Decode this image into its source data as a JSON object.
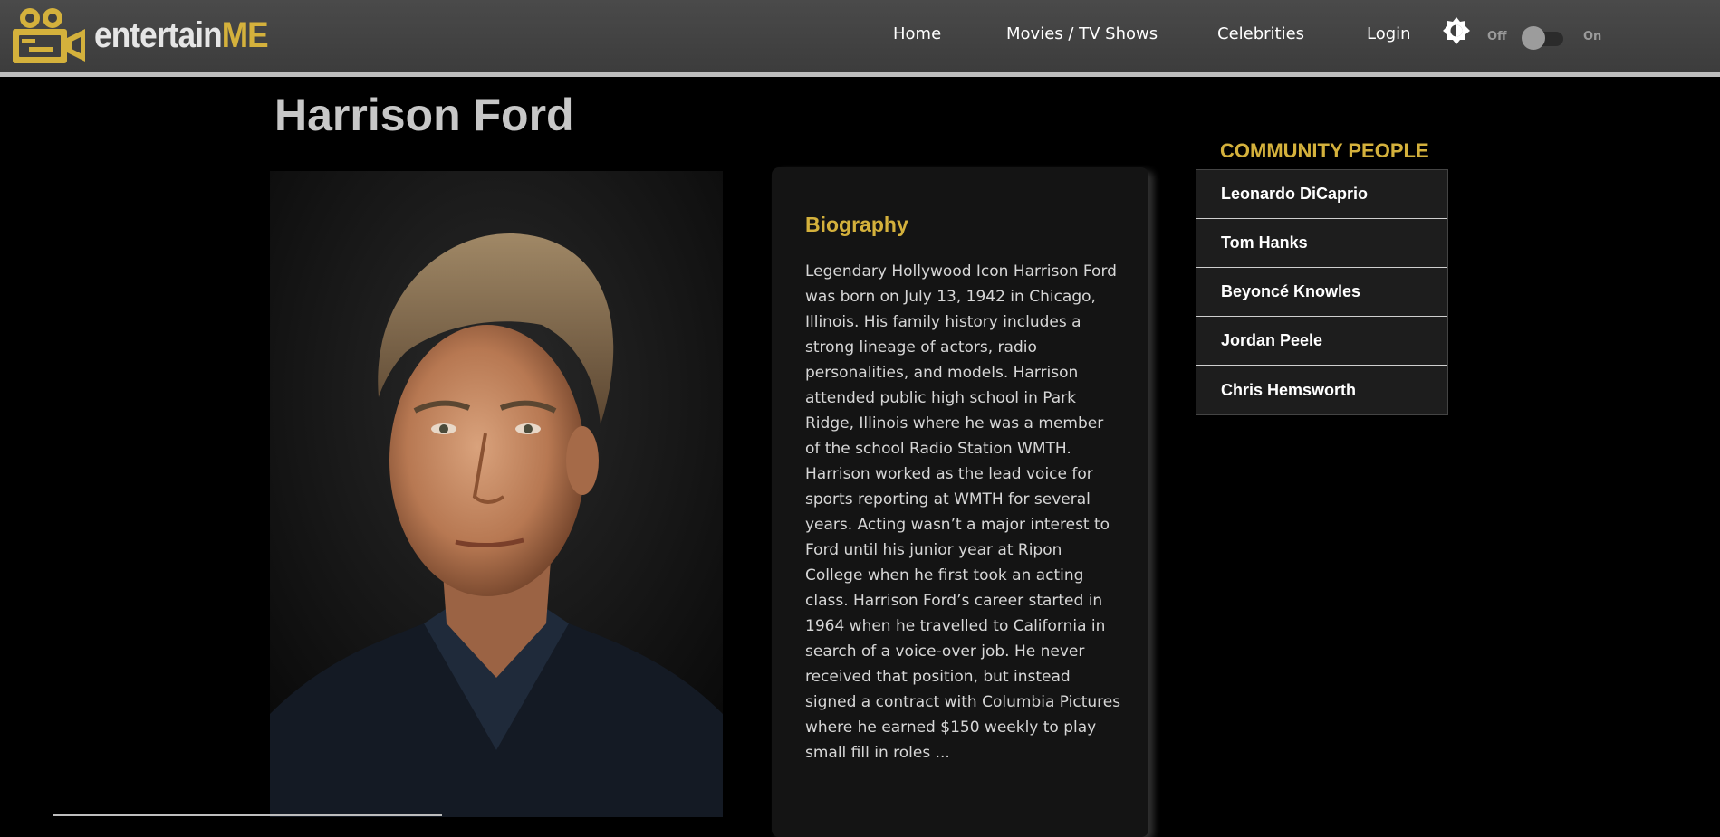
{
  "navbar": {
    "brand_part1": "entertain",
    "brand_part2": "ME",
    "links": [
      "Home",
      "Movies / TV Shows",
      "Celebrities",
      "Login"
    ],
    "theme_icon": "brightness-icon",
    "toggle_off_label": "Off",
    "toggle_on_label": "On",
    "toggle_state": "off"
  },
  "page": {
    "title": "Harrison Ford"
  },
  "biography": {
    "heading": "Biography",
    "text": "Legendary Hollywood Icon Harrison Ford was born on July 13, 1942 in Chicago, Illinois.  His family history includes a strong lineage of actors, radio personalities, and models. Harrison attended public high school in Park Ridge, Illinois where he was a member of the school Radio Station WMTH. Harrison worked as the lead voice for sports reporting at WMTH for several years.  Acting wasn’t a major interest to Ford until his junior year at Ripon College when he first took an acting class. Harrison Ford’s career started in 1964 when he travelled to California in search of a voice-over job. He never received that position, but instead signed a contract with Columbia Pictures where he earned $150 weekly to play small fill in roles ..."
  },
  "community": {
    "title": "COMMUNITY PEOPLE",
    "people": [
      "Leonardo DiCaprio",
      "Tom Hanks",
      "Beyoncé Knowles",
      "Jordan Peele",
      "Chris Hemsworth"
    ]
  },
  "colors": {
    "accent": "#d4b13c",
    "background": "#000000",
    "navbar": "#444444"
  }
}
